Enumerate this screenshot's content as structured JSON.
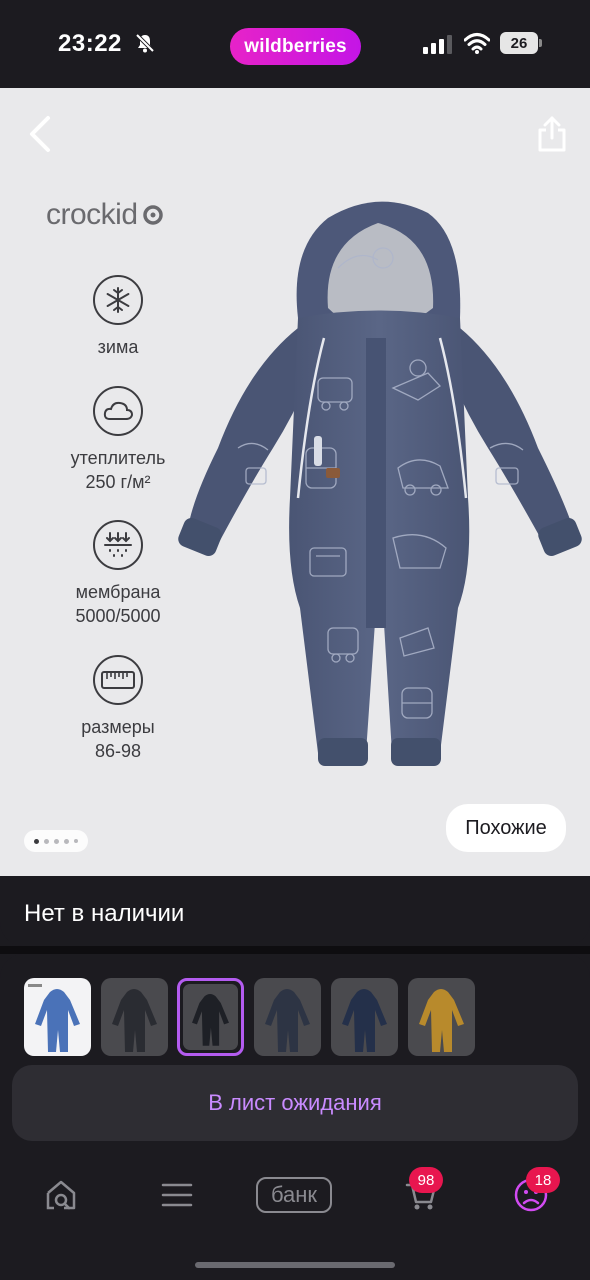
{
  "status_bar": {
    "time": "23:22",
    "app_pill": "wildberries",
    "battery": "26"
  },
  "product": {
    "brand": "crockid",
    "features": [
      {
        "icon": "snowflake-icon",
        "label": "зима"
      },
      {
        "icon": "cloud-icon",
        "label": "утеплитель 250 г/м²"
      },
      {
        "icon": "membrane-icon",
        "label": "мембрана 5000/5000"
      },
      {
        "icon": "ruler-icon",
        "label": "размеры 86-98"
      }
    ],
    "similar_label": "Похожие",
    "gallery_pages": 5,
    "gallery_active_page": 1
  },
  "availability": {
    "text": "Нет в наличии"
  },
  "variants": {
    "colors": [
      "#4a72b8",
      "#3a3d44",
      "#25272e",
      "#2d3444",
      "#24304a",
      "#b88a2c"
    ],
    "selected_index": 2
  },
  "actions": {
    "wait_list_label": "В лист ожидания"
  },
  "bottom_nav": {
    "bank_label": "банк",
    "cart_badge": "98",
    "profile_badge": "18"
  },
  "colors": {
    "brand_pill": "#cb18e0",
    "accent_text": "#c98bff",
    "badge": "#e8164f",
    "background": "#1c1b20"
  }
}
